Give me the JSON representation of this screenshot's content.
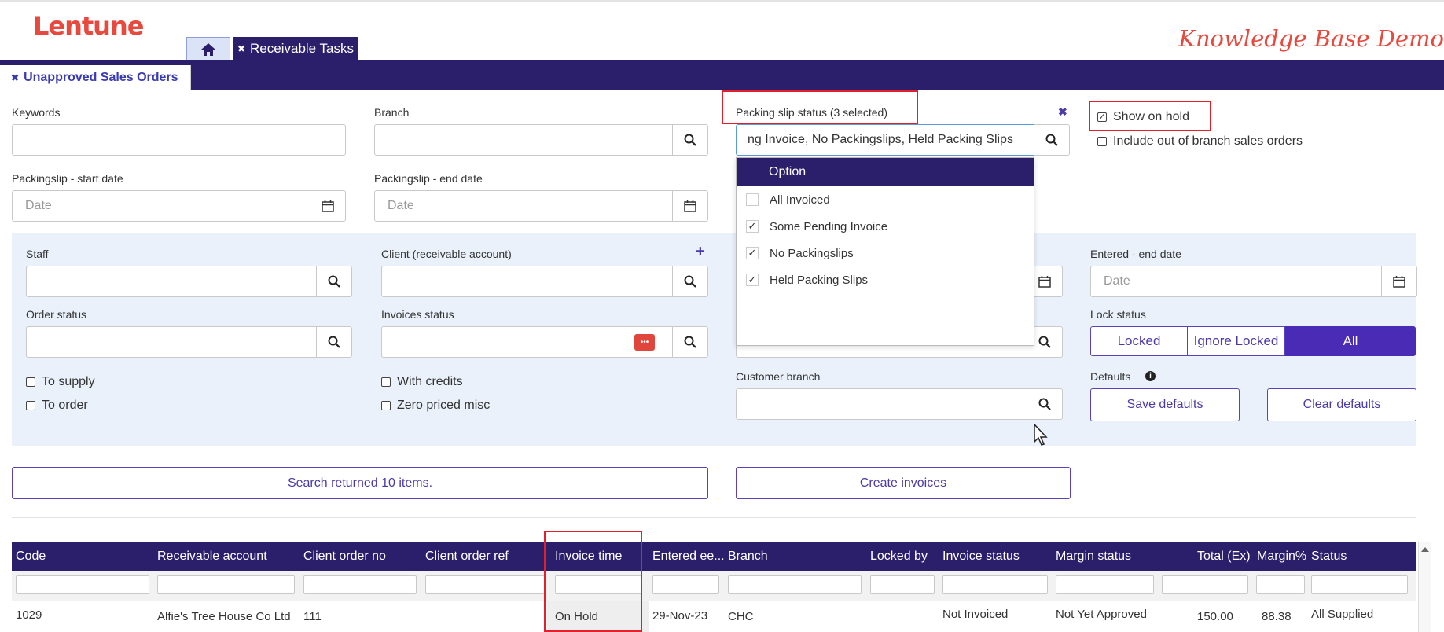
{
  "app": {
    "logo": "Lentune",
    "banner": "Knowledge Base Demo"
  },
  "tabs": {
    "receivable": "Receivable Tasks",
    "close_glyph": "✖"
  },
  "subtab": {
    "label": "Unapproved Sales Orders"
  },
  "filters": {
    "keywords_label": "Keywords",
    "branch_label": "Branch",
    "packing_label": "Packing slip status (3 selected)",
    "packing_value": "ng Invoice, No Packingslips, Held Packing Slips",
    "show_on_hold": "Show on hold",
    "include_out": "Include out of branch sales orders",
    "ps_start_label": "Packingslip - start date",
    "ps_end_label": "Packingslip - end date",
    "date_placeholder": "Date"
  },
  "dropdown": {
    "header": "Option",
    "items": [
      {
        "label": "All Invoiced",
        "checked": false
      },
      {
        "label": "Some Pending Invoice",
        "checked": true
      },
      {
        "label": "No Packingslips",
        "checked": true
      },
      {
        "label": "Held Packing Slips",
        "checked": true
      }
    ]
  },
  "panel": {
    "staff_label": "Staff",
    "client_label": "Client (receivable account)",
    "entered_end_label": "Entered - end date",
    "order_status_label": "Order status",
    "invoices_status_label": "Invoices status",
    "lock_status_label": "Lock status",
    "to_supply": "To supply",
    "to_order": "To order",
    "with_credits": "With credits",
    "zero_priced": "Zero priced misc",
    "customer_branch_label": "Customer branch",
    "defaults_label": "Defaults",
    "save_defaults": "Save defaults",
    "clear_defaults": "Clear defaults",
    "lock_options": [
      "Locked",
      "Ignore Locked",
      "All"
    ],
    "ellipsis": "•••",
    "plus": "+"
  },
  "actions": {
    "search_result": "Search returned 10 items.",
    "create_invoices": "Create invoices"
  },
  "table": {
    "headers": [
      "Code",
      "Receivable account",
      "Client order no",
      "Client order ref",
      "Invoice time",
      "Entered ee...",
      "Branch",
      "Locked by",
      "Invoice status",
      "Margin status",
      "Total (Ex)",
      "Margin%",
      "Status"
    ],
    "rows": [
      [
        "1029",
        "Alfie's Tree House Co Ltd",
        "111",
        "",
        "On Hold",
        "29-Nov-23",
        "CHC",
        "",
        "Not Invoiced",
        "Not Yet Approved",
        "150.00",
        "88.38",
        "All Supplied"
      ]
    ]
  },
  "colors": {
    "brand": "#e8493e",
    "navy": "#2b1e6b",
    "accent": "#4a3aa8",
    "highlight": "#e0202a"
  }
}
